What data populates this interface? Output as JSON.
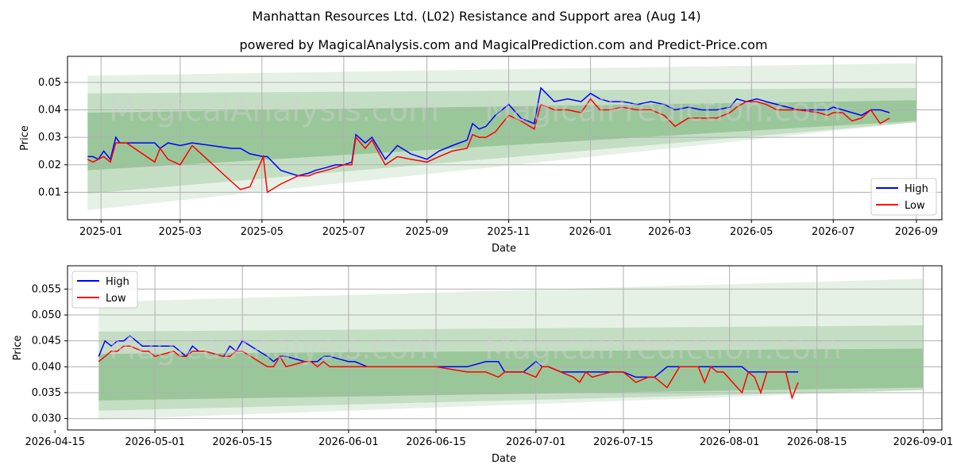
{
  "title": "Manhattan Resources Ltd. (L02) Resistance and Support area (Aug 14)",
  "subtitle": "powered by MagicalAnalysis.com and MagicalPrediction.com and Predict-Price.com",
  "watermarks": [
    "MagicalAnalysis.com",
    "MagicalPrediction.com"
  ],
  "colors": {
    "high": "#0000ff",
    "low": "#ff0000",
    "band": "#2e8b2e",
    "grid": "#b0b0b0"
  },
  "chart_data": [
    {
      "type": "line",
      "xlabel": "Date",
      "ylabel": "Price",
      "xlim": [
        "2024-12-07",
        "2026-09-20"
      ],
      "ylim": [
        0.0,
        0.0595
      ],
      "x_ticks": [
        "2025-01",
        "2025-03",
        "2025-05",
        "2025-07",
        "2025-09",
        "2025-11",
        "2026-01",
        "2026-03",
        "2026-05",
        "2026-07",
        "2026-09"
      ],
      "y_ticks": [
        0.01,
        0.02,
        0.03,
        0.04,
        0.05
      ],
      "y_tick_labels": [
        "0.01",
        "0.02",
        "0.03",
        "0.04",
        "0.05"
      ],
      "grid": true,
      "legend": "lower right",
      "bands_start": "2024-12-22",
      "bands_end": "2026-09-01",
      "bands": [
        {
          "start": [
            0.0035,
            0.0525
          ],
          "end": [
            0.0355,
            0.057
          ],
          "opacity": 0.12
        },
        {
          "start": [
            0.0095,
            0.046
          ],
          "end": [
            0.0355,
            0.048
          ],
          "opacity": 0.18
        },
        {
          "start": [
            0.018,
            0.039
          ],
          "end": [
            0.036,
            0.0435
          ],
          "opacity": 0.28
        }
      ],
      "series": [
        {
          "name": "High",
          "color": "#0000ff",
          "x": [
            "2024-12-22",
            "2024-12-26",
            "2024-12-30",
            "2025-01-03",
            "2025-01-08",
            "2025-01-12",
            "2025-01-15",
            "2025-01-20",
            "2025-02-10",
            "2025-02-14",
            "2025-02-20",
            "2025-03-01",
            "2025-03-10",
            "2025-04-08",
            "2025-04-15",
            "2025-04-22",
            "2025-05-02",
            "2025-05-05",
            "2025-05-15",
            "2025-05-28",
            "2025-06-05",
            "2025-06-10",
            "2025-06-18",
            "2025-06-25",
            "2025-07-01",
            "2025-07-07",
            "2025-07-10",
            "2025-07-17",
            "2025-07-22",
            "2025-08-01",
            "2025-08-10",
            "2025-08-20",
            "2025-09-01",
            "2025-09-10",
            "2025-09-20",
            "2025-10-01",
            "2025-10-05",
            "2025-10-10",
            "2025-10-15",
            "2025-10-22",
            "2025-11-01",
            "2025-11-10",
            "2025-11-20",
            "2025-11-25",
            "2025-12-05",
            "2025-12-15",
            "2025-12-25",
            "2026-01-01",
            "2026-01-08",
            "2026-01-15",
            "2026-01-25",
            "2026-02-05",
            "2026-02-15",
            "2026-02-25",
            "2026-03-05",
            "2026-03-15",
            "2026-03-25",
            "2026-04-05",
            "2026-04-15",
            "2026-04-20",
            "2026-04-27",
            "2026-05-05",
            "2026-05-12",
            "2026-05-20",
            "2026-05-28",
            "2026-06-05",
            "2026-06-20",
            "2026-06-27",
            "2026-07-01",
            "2026-07-08",
            "2026-07-15",
            "2026-07-22",
            "2026-07-29",
            "2026-08-05",
            "2026-08-12"
          ],
          "y": [
            0.023,
            0.023,
            0.022,
            0.025,
            0.022,
            0.03,
            0.028,
            0.028,
            0.028,
            0.026,
            0.028,
            0.027,
            0.028,
            0.026,
            0.026,
            0.024,
            0.023,
            0.023,
            0.018,
            0.016,
            0.017,
            0.018,
            0.019,
            0.02,
            0.02,
            0.021,
            0.031,
            0.028,
            0.03,
            0.022,
            0.027,
            0.024,
            0.022,
            0.025,
            0.027,
            0.029,
            0.035,
            0.033,
            0.034,
            0.038,
            0.042,
            0.037,
            0.035,
            0.048,
            0.043,
            0.044,
            0.043,
            0.046,
            0.044,
            0.043,
            0.043,
            0.042,
            0.043,
            0.042,
            0.04,
            0.041,
            0.04,
            0.04,
            0.041,
            0.044,
            0.043,
            0.044,
            0.043,
            0.042,
            0.041,
            0.04,
            0.04,
            0.04,
            0.041,
            0.04,
            0.039,
            0.038,
            0.04,
            0.04,
            0.039
          ]
        },
        {
          "name": "Low",
          "color": "#ff0000",
          "x": [
            "2024-12-22",
            "2024-12-26",
            "2024-12-30",
            "2025-01-03",
            "2025-01-08",
            "2025-01-12",
            "2025-01-15",
            "2025-01-20",
            "2025-02-10",
            "2025-02-14",
            "2025-02-20",
            "2025-03-01",
            "2025-03-10",
            "2025-04-08",
            "2025-04-15",
            "2025-04-22",
            "2025-05-02",
            "2025-05-05",
            "2025-05-15",
            "2025-05-28",
            "2025-06-05",
            "2025-06-10",
            "2025-06-18",
            "2025-06-25",
            "2025-07-01",
            "2025-07-07",
            "2025-07-10",
            "2025-07-17",
            "2025-07-22",
            "2025-08-01",
            "2025-08-10",
            "2025-08-20",
            "2025-09-01",
            "2025-09-10",
            "2025-09-20",
            "2025-10-01",
            "2025-10-05",
            "2025-10-10",
            "2025-10-15",
            "2025-10-22",
            "2025-11-01",
            "2025-11-10",
            "2025-11-20",
            "2025-11-25",
            "2025-12-05",
            "2025-12-15",
            "2025-12-25",
            "2026-01-01",
            "2026-01-08",
            "2026-01-15",
            "2026-01-25",
            "2026-02-05",
            "2026-02-15",
            "2026-02-25",
            "2026-03-05",
            "2026-03-15",
            "2026-03-25",
            "2026-04-05",
            "2026-04-15",
            "2026-04-20",
            "2026-04-27",
            "2026-05-05",
            "2026-05-12",
            "2026-05-20",
            "2026-05-28",
            "2026-06-05",
            "2026-06-20",
            "2026-06-27",
            "2026-07-01",
            "2026-07-08",
            "2026-07-15",
            "2026-07-22",
            "2026-07-29",
            "2026-08-05",
            "2026-08-12"
          ],
          "y": [
            0.022,
            0.021,
            0.022,
            0.023,
            0.021,
            0.028,
            0.028,
            0.028,
            0.021,
            0.026,
            0.022,
            0.02,
            0.027,
            0.014,
            0.011,
            0.012,
            0.023,
            0.01,
            0.013,
            0.016,
            0.016,
            0.017,
            0.018,
            0.019,
            0.02,
            0.02,
            0.03,
            0.026,
            0.029,
            0.02,
            0.023,
            0.022,
            0.021,
            0.023,
            0.025,
            0.026,
            0.031,
            0.03,
            0.03,
            0.032,
            0.038,
            0.036,
            0.033,
            0.042,
            0.04,
            0.04,
            0.039,
            0.044,
            0.04,
            0.04,
            0.041,
            0.04,
            0.04,
            0.038,
            0.034,
            0.037,
            0.037,
            0.037,
            0.039,
            0.041,
            0.043,
            0.043,
            0.042,
            0.04,
            0.04,
            0.04,
            0.039,
            0.038,
            0.039,
            0.039,
            0.036,
            0.037,
            0.04,
            0.035,
            0.037
          ]
        }
      ]
    },
    {
      "type": "line",
      "xlabel": "Date",
      "ylabel": "Price",
      "xlim": [
        "2026-04-17",
        "2026-09-04"
      ],
      "ylim": [
        0.0278,
        0.0595
      ],
      "x_ticks": [
        "2026-04-15",
        "2026-05-01",
        "2026-05-15",
        "2026-06-01",
        "2026-06-15",
        "2026-07-01",
        "2026-07-15",
        "2026-08-01",
        "2026-08-15",
        "2026-09-01"
      ],
      "y_ticks": [
        0.03,
        0.035,
        0.04,
        0.045,
        0.05,
        0.055
      ],
      "y_tick_labels": [
        "0.030",
        "0.035",
        "0.040",
        "0.045",
        "0.050",
        "0.055"
      ],
      "grid": true,
      "legend": "upper left",
      "bands_start": "2026-04-22",
      "bands_end": "2026-09-01",
      "bands": [
        {
          "start": [
            0.0298,
            0.0525
          ],
          "end": [
            0.0355,
            0.057
          ],
          "opacity": 0.12
        },
        {
          "start": [
            0.0315,
            0.0468
          ],
          "end": [
            0.0355,
            0.048
          ],
          "opacity": 0.18
        },
        {
          "start": [
            0.0335,
            0.0425
          ],
          "end": [
            0.036,
            0.0435
          ],
          "opacity": 0.28
        }
      ],
      "series": [
        {
          "name": "High",
          "color": "#0000ff",
          "x": [
            "2026-04-22",
            "2026-04-23",
            "2026-04-24",
            "2026-04-25",
            "2026-04-26",
            "2026-04-27",
            "2026-04-29",
            "2026-04-30",
            "2026-05-01",
            "2026-05-04",
            "2026-05-05",
            "2026-05-06",
            "2026-05-07",
            "2026-05-08",
            "2026-05-09",
            "2026-05-12",
            "2026-05-13",
            "2026-05-14",
            "2026-05-15",
            "2026-05-19",
            "2026-05-20",
            "2026-05-21",
            "2026-05-22",
            "2026-05-25",
            "2026-05-26",
            "2026-05-27",
            "2026-05-28",
            "2026-05-29",
            "2026-06-01",
            "2026-06-02",
            "2026-06-04",
            "2026-06-08",
            "2026-06-10",
            "2026-06-15",
            "2026-06-20",
            "2026-06-23",
            "2026-06-25",
            "2026-06-26",
            "2026-06-29",
            "2026-07-01",
            "2026-07-02",
            "2026-07-03",
            "2026-07-05",
            "2026-07-07",
            "2026-07-08",
            "2026-07-09",
            "2026-07-10",
            "2026-07-13",
            "2026-07-15",
            "2026-07-17",
            "2026-07-19",
            "2026-07-20",
            "2026-07-21",
            "2026-07-22",
            "2026-07-24",
            "2026-07-27",
            "2026-07-28",
            "2026-07-29",
            "2026-07-30",
            "2026-07-31",
            "2026-08-03",
            "2026-08-04",
            "2026-08-05",
            "2026-08-06",
            "2026-08-07",
            "2026-08-10",
            "2026-08-11",
            "2026-08-12"
          ],
          "y": [
            0.042,
            0.045,
            0.044,
            0.045,
            0.045,
            0.046,
            0.044,
            0.044,
            0.044,
            0.044,
            0.043,
            0.042,
            0.044,
            0.043,
            0.043,
            0.042,
            0.044,
            0.043,
            0.045,
            0.042,
            0.041,
            0.042,
            0.042,
            0.041,
            0.041,
            0.041,
            0.042,
            0.042,
            0.041,
            0.041,
            0.04,
            0.04,
            0.04,
            0.04,
            0.04,
            0.041,
            0.041,
            0.039,
            0.039,
            0.041,
            0.04,
            0.04,
            0.039,
            0.039,
            0.039,
            0.039,
            0.039,
            0.039,
            0.039,
            0.038,
            0.038,
            0.038,
            0.039,
            0.04,
            0.04,
            0.04,
            0.04,
            0.04,
            0.04,
            0.04,
            0.04,
            0.039,
            0.039,
            0.039,
            0.039,
            0.039,
            0.039,
            0.039
          ]
        },
        {
          "name": "Low",
          "color": "#ff0000",
          "x": [
            "2026-04-22",
            "2026-04-23",
            "2026-04-24",
            "2026-04-25",
            "2026-04-26",
            "2026-04-27",
            "2026-04-29",
            "2026-04-30",
            "2026-05-01",
            "2026-05-04",
            "2026-05-05",
            "2026-05-06",
            "2026-05-07",
            "2026-05-08",
            "2026-05-09",
            "2026-05-12",
            "2026-05-13",
            "2026-05-14",
            "2026-05-15",
            "2026-05-19",
            "2026-05-20",
            "2026-05-21",
            "2026-05-22",
            "2026-05-25",
            "2026-05-26",
            "2026-05-27",
            "2026-05-28",
            "2026-05-29",
            "2026-06-01",
            "2026-06-02",
            "2026-06-04",
            "2026-06-08",
            "2026-06-10",
            "2026-06-15",
            "2026-06-20",
            "2026-06-23",
            "2026-06-25",
            "2026-06-26",
            "2026-06-29",
            "2026-07-01",
            "2026-07-02",
            "2026-07-03",
            "2026-07-05",
            "2026-07-07",
            "2026-07-08",
            "2026-07-09",
            "2026-07-10",
            "2026-07-13",
            "2026-07-15",
            "2026-07-17",
            "2026-07-19",
            "2026-07-20",
            "2026-07-21",
            "2026-07-22",
            "2026-07-24",
            "2026-07-27",
            "2026-07-28",
            "2026-07-29",
            "2026-07-30",
            "2026-07-31",
            "2026-08-03",
            "2026-08-04",
            "2026-08-05",
            "2026-08-06",
            "2026-08-07",
            "2026-08-10",
            "2026-08-11",
            "2026-08-12"
          ],
          "y": [
            0.041,
            0.042,
            0.043,
            0.043,
            0.044,
            0.044,
            0.043,
            0.043,
            0.042,
            0.043,
            0.042,
            0.042,
            0.043,
            0.043,
            0.043,
            0.042,
            0.042,
            0.043,
            0.043,
            0.04,
            0.04,
            0.042,
            0.04,
            0.041,
            0.041,
            0.04,
            0.041,
            0.04,
            0.04,
            0.04,
            0.04,
            0.04,
            0.04,
            0.04,
            0.039,
            0.039,
            0.038,
            0.039,
            0.039,
            0.038,
            0.04,
            0.04,
            0.039,
            0.038,
            0.037,
            0.039,
            0.038,
            0.039,
            0.039,
            0.037,
            0.038,
            0.038,
            0.037,
            0.036,
            0.04,
            0.04,
            0.037,
            0.04,
            0.039,
            0.039,
            0.035,
            0.039,
            0.038,
            0.035,
            0.039,
            0.039,
            0.034,
            0.037
          ]
        }
      ]
    }
  ]
}
